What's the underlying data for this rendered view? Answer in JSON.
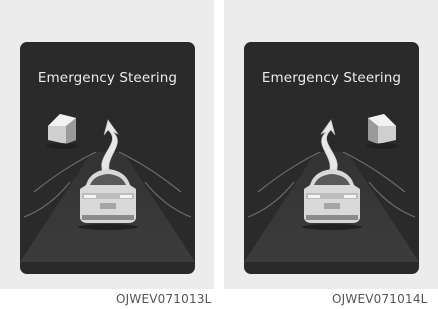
{
  "figures": [
    {
      "title": "Emergency Steering",
      "code": "OJWEV071013L",
      "obstacle_side": "left"
    },
    {
      "title": "Emergency Steering",
      "code": "OJWEV071014L",
      "obstacle_side": "right"
    }
  ],
  "colors": {
    "screen_bg": "#2a2a2a",
    "panel_bg": "#ececec",
    "text": "#ededed"
  }
}
